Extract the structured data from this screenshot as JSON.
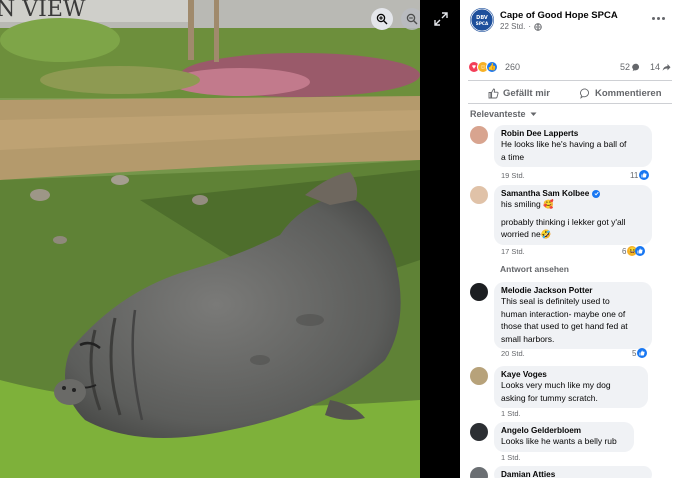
{
  "page": {
    "name": "Cape of Good Hope SPCA",
    "avatar_text_top": "DBV",
    "avatar_text_bottom": "SPCA",
    "time": "22 Std.",
    "privacy_icon": "globe-icon"
  },
  "photo": {
    "sign_text": "N VIEW",
    "subject": "sleeping elephant seal on grass"
  },
  "reactions": {
    "icons": [
      "love-icon",
      "care-icon",
      "like-icon"
    ],
    "count": "260",
    "comments": "52",
    "shares": "14"
  },
  "actions": {
    "like_label": "Gefällt mir",
    "comment_label": "Kommentieren"
  },
  "sort": {
    "label": "Relevanteste"
  },
  "comments": [
    {
      "name": "Robin Dee Lapperts",
      "lines": [
        "He looks like he's having a ball of",
        "a time"
      ],
      "time": "19 Std.",
      "reactions": "11"
    },
    {
      "name": "Samantha Sam Kolbee",
      "lines": [
        "his smiling 🥰",
        "",
        "probably thinking i lekker got y'all",
        "worried ne🤣"
      ],
      "time": "17 Std.",
      "reactions": "6"
    },
    {
      "name": "Melodie Jackson Potter",
      "lines": [
        "This seal is definitely used to",
        "human interaction- maybe one of",
        "those that used to get hand fed at",
        "small harbors."
      ],
      "time": "20 Std.",
      "reactions": "5"
    },
    {
      "name": "Kaye Voges",
      "lines": [
        "Looks very much like my dog",
        "asking for tummy scratch."
      ],
      "time": "1 Std.",
      "reactions": ""
    },
    {
      "name": "Angelo Gelderbloem",
      "lines": [
        "Looks like he wants a belly rub"
      ],
      "time": "1 Std.",
      "reactions": ""
    },
    {
      "name": "Damian Atties",
      "lines": [],
      "time": "",
      "reactions": ""
    }
  ],
  "see_replies": "Antwort ansehen",
  "colors": {
    "accent": "#1877f2",
    "bubble": "#f0f2f5",
    "secondary_text": "#65676b"
  }
}
